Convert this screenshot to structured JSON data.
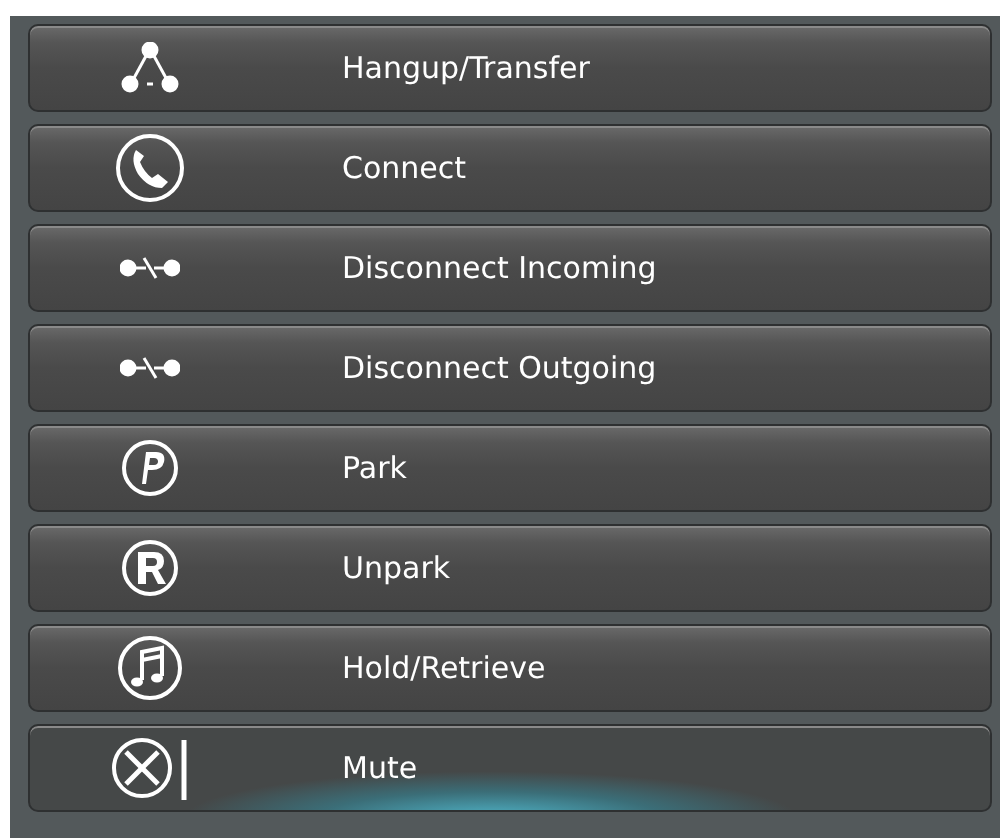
{
  "buttons": [
    {
      "label": "Hangup/Transfer",
      "kind": "nodes",
      "highlighted": false
    },
    {
      "label": "Connect",
      "kind": "phone",
      "highlighted": false
    },
    {
      "label": "Disconnect Incoming",
      "kind": "disconnect",
      "highlighted": false
    },
    {
      "label": "Disconnect Outgoing",
      "kind": "disconnect",
      "highlighted": false
    },
    {
      "label": "Park",
      "kind": "p",
      "highlighted": false
    },
    {
      "label": "Unpark",
      "kind": "r",
      "highlighted": false
    },
    {
      "label": "Hold/Retrieve",
      "kind": "note",
      "highlighted": false
    },
    {
      "label": "Mute",
      "kind": "mute",
      "highlighted": true
    }
  ]
}
